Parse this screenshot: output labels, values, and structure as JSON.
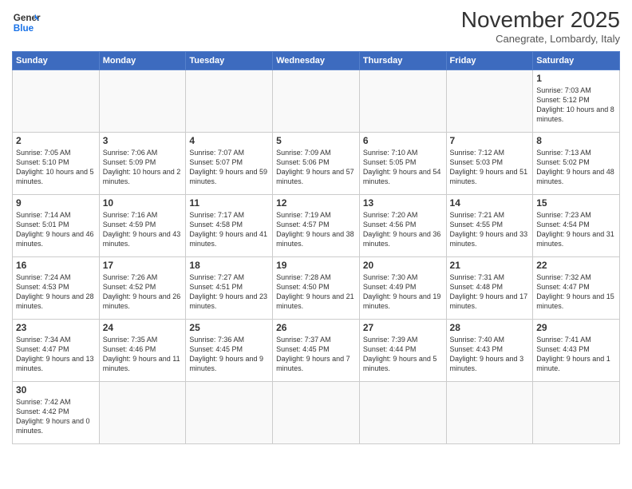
{
  "header": {
    "logo_general": "General",
    "logo_blue": "Blue",
    "month": "November 2025",
    "location": "Canegrate, Lombardy, Italy"
  },
  "days_of_week": [
    "Sunday",
    "Monday",
    "Tuesday",
    "Wednesday",
    "Thursday",
    "Friday",
    "Saturday"
  ],
  "weeks": [
    [
      {
        "day": "",
        "info": ""
      },
      {
        "day": "",
        "info": ""
      },
      {
        "day": "",
        "info": ""
      },
      {
        "day": "",
        "info": ""
      },
      {
        "day": "",
        "info": ""
      },
      {
        "day": "",
        "info": ""
      },
      {
        "day": "1",
        "info": "Sunrise: 7:03 AM\nSunset: 5:12 PM\nDaylight: 10 hours and 8 minutes."
      }
    ],
    [
      {
        "day": "2",
        "info": "Sunrise: 7:05 AM\nSunset: 5:10 PM\nDaylight: 10 hours and 5 minutes."
      },
      {
        "day": "3",
        "info": "Sunrise: 7:06 AM\nSunset: 5:09 PM\nDaylight: 10 hours and 2 minutes."
      },
      {
        "day": "4",
        "info": "Sunrise: 7:07 AM\nSunset: 5:07 PM\nDaylight: 9 hours and 59 minutes."
      },
      {
        "day": "5",
        "info": "Sunrise: 7:09 AM\nSunset: 5:06 PM\nDaylight: 9 hours and 57 minutes."
      },
      {
        "day": "6",
        "info": "Sunrise: 7:10 AM\nSunset: 5:05 PM\nDaylight: 9 hours and 54 minutes."
      },
      {
        "day": "7",
        "info": "Sunrise: 7:12 AM\nSunset: 5:03 PM\nDaylight: 9 hours and 51 minutes."
      },
      {
        "day": "8",
        "info": "Sunrise: 7:13 AM\nSunset: 5:02 PM\nDaylight: 9 hours and 48 minutes."
      }
    ],
    [
      {
        "day": "9",
        "info": "Sunrise: 7:14 AM\nSunset: 5:01 PM\nDaylight: 9 hours and 46 minutes."
      },
      {
        "day": "10",
        "info": "Sunrise: 7:16 AM\nSunset: 4:59 PM\nDaylight: 9 hours and 43 minutes."
      },
      {
        "day": "11",
        "info": "Sunrise: 7:17 AM\nSunset: 4:58 PM\nDaylight: 9 hours and 41 minutes."
      },
      {
        "day": "12",
        "info": "Sunrise: 7:19 AM\nSunset: 4:57 PM\nDaylight: 9 hours and 38 minutes."
      },
      {
        "day": "13",
        "info": "Sunrise: 7:20 AM\nSunset: 4:56 PM\nDaylight: 9 hours and 36 minutes."
      },
      {
        "day": "14",
        "info": "Sunrise: 7:21 AM\nSunset: 4:55 PM\nDaylight: 9 hours and 33 minutes."
      },
      {
        "day": "15",
        "info": "Sunrise: 7:23 AM\nSunset: 4:54 PM\nDaylight: 9 hours and 31 minutes."
      }
    ],
    [
      {
        "day": "16",
        "info": "Sunrise: 7:24 AM\nSunset: 4:53 PM\nDaylight: 9 hours and 28 minutes."
      },
      {
        "day": "17",
        "info": "Sunrise: 7:26 AM\nSunset: 4:52 PM\nDaylight: 9 hours and 26 minutes."
      },
      {
        "day": "18",
        "info": "Sunrise: 7:27 AM\nSunset: 4:51 PM\nDaylight: 9 hours and 23 minutes."
      },
      {
        "day": "19",
        "info": "Sunrise: 7:28 AM\nSunset: 4:50 PM\nDaylight: 9 hours and 21 minutes."
      },
      {
        "day": "20",
        "info": "Sunrise: 7:30 AM\nSunset: 4:49 PM\nDaylight: 9 hours and 19 minutes."
      },
      {
        "day": "21",
        "info": "Sunrise: 7:31 AM\nSunset: 4:48 PM\nDaylight: 9 hours and 17 minutes."
      },
      {
        "day": "22",
        "info": "Sunrise: 7:32 AM\nSunset: 4:47 PM\nDaylight: 9 hours and 15 minutes."
      }
    ],
    [
      {
        "day": "23",
        "info": "Sunrise: 7:34 AM\nSunset: 4:47 PM\nDaylight: 9 hours and 13 minutes."
      },
      {
        "day": "24",
        "info": "Sunrise: 7:35 AM\nSunset: 4:46 PM\nDaylight: 9 hours and 11 minutes."
      },
      {
        "day": "25",
        "info": "Sunrise: 7:36 AM\nSunset: 4:45 PM\nDaylight: 9 hours and 9 minutes."
      },
      {
        "day": "26",
        "info": "Sunrise: 7:37 AM\nSunset: 4:45 PM\nDaylight: 9 hours and 7 minutes."
      },
      {
        "day": "27",
        "info": "Sunrise: 7:39 AM\nSunset: 4:44 PM\nDaylight: 9 hours and 5 minutes."
      },
      {
        "day": "28",
        "info": "Sunrise: 7:40 AM\nSunset: 4:43 PM\nDaylight: 9 hours and 3 minutes."
      },
      {
        "day": "29",
        "info": "Sunrise: 7:41 AM\nSunset: 4:43 PM\nDaylight: 9 hours and 1 minute."
      }
    ],
    [
      {
        "day": "30",
        "info": "Sunrise: 7:42 AM\nSunset: 4:42 PM\nDaylight: 9 hours and 0 minutes."
      },
      {
        "day": "",
        "info": ""
      },
      {
        "day": "",
        "info": ""
      },
      {
        "day": "",
        "info": ""
      },
      {
        "day": "",
        "info": ""
      },
      {
        "day": "",
        "info": ""
      },
      {
        "day": "",
        "info": ""
      }
    ]
  ]
}
